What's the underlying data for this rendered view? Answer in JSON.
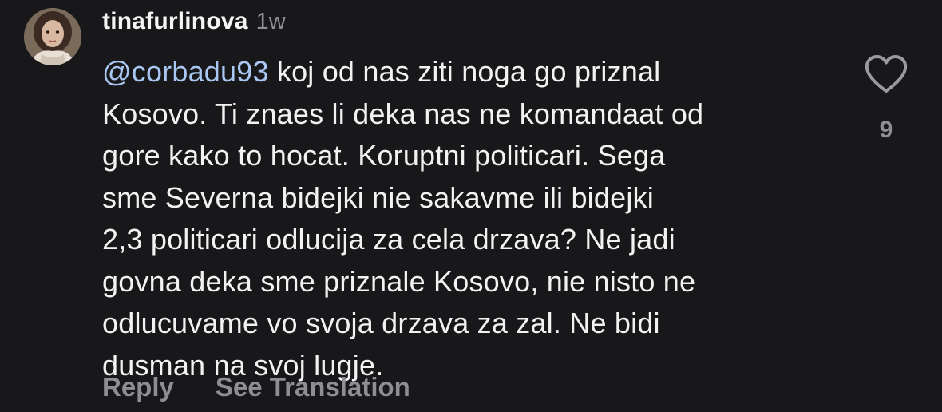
{
  "comment": {
    "username": "tinafurlinova",
    "timestamp": "1w",
    "mention": "@corbadu93",
    "lines": [
      " koj od nas ziti noga go priznal",
      "Kosovo. Ti znaes li deka nas ne komandaat od",
      "gore kako to hocat. Koruptni politicari. Sega",
      "sme Severna bidejki nie sakavme ili bidejki",
      "2,3 politicari odlucija za cela drzava? Ne jadi",
      "govna deka sme priznale Kosovo, nie nisto ne",
      "odlucuvame vo svoja drzava za zal. Ne bidi",
      "dusman na svoj lugje."
    ],
    "like_icon": "heart-outline-icon",
    "like_count": "9"
  },
  "actions": {
    "reply_label": "Reply",
    "see_translation_label": "See Translation"
  },
  "colors": {
    "background": "#18181b",
    "text": "#f5f5f5",
    "mention": "#a9c7f2",
    "muted": "#8e8e93"
  }
}
